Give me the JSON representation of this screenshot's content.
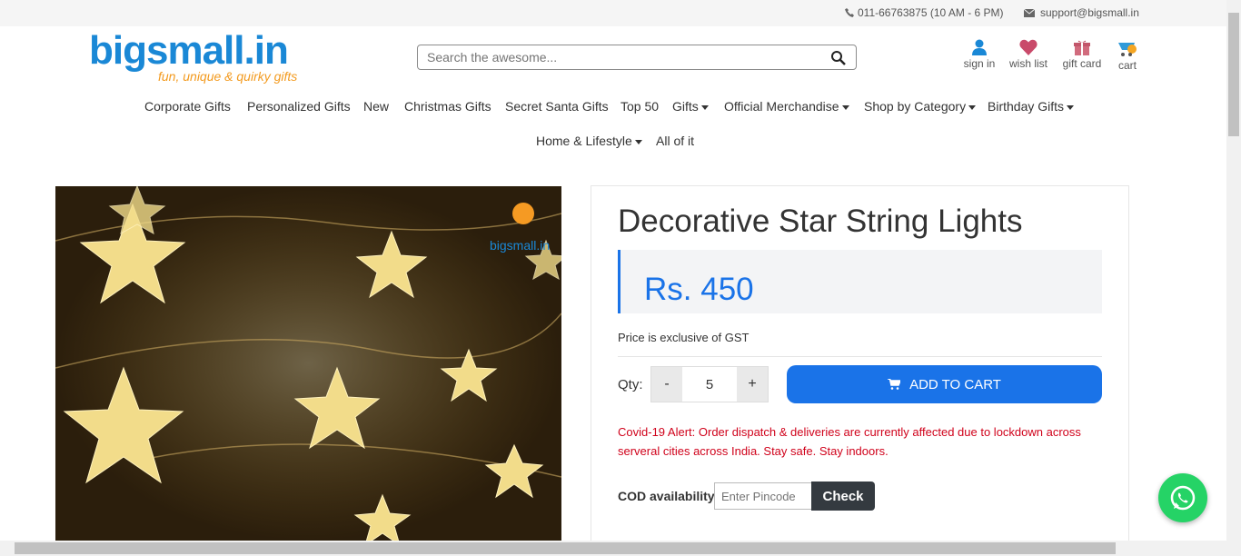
{
  "topbar": {
    "phone": "011-66763875 (10 AM - 6 PM)",
    "email": "support@bigsmall.in"
  },
  "logo": {
    "name": "bigsmall.in",
    "tagline": "fun, unique & quirky gifts"
  },
  "search": {
    "placeholder": "Search the awesome..."
  },
  "header_icons": {
    "signin": "sign in",
    "wishlist": "wish list",
    "giftcard": "gift card",
    "cart": "cart"
  },
  "menu": {
    "items": [
      "Corporate Gifts",
      "Personalized Gifts",
      "New",
      "Christmas Gifts",
      "Secret Santa Gifts",
      "Top 50",
      "Gifts",
      "Official Merchandise",
      "Shop by Category",
      "Birthday Gifts",
      "Home & Lifestyle",
      "All of it"
    ]
  },
  "product": {
    "title": "Decorative Star String Lights",
    "price": "Rs. 450",
    "gst_note": "Price is exclusive of GST",
    "qty_label": "Qty:",
    "qty_minus": "-",
    "qty_value": "5",
    "qty_plus": "+",
    "add_to_cart": "ADD TO CART",
    "alert": "Covid-19 Alert: Order dispatch & deliveries are currently affected due to lockdown across serveral cities across India. Stay safe. Stay indoors.",
    "cod_label": "COD availability",
    "pincode_placeholder": "Enter Pincode",
    "check": "Check",
    "watermark": "bigsmall.in"
  },
  "colors": {
    "brand_blue": "#1a88d6",
    "accent_blue": "#1a73e8",
    "alert_red": "#d0021b",
    "whatsapp_green": "#25d366"
  }
}
